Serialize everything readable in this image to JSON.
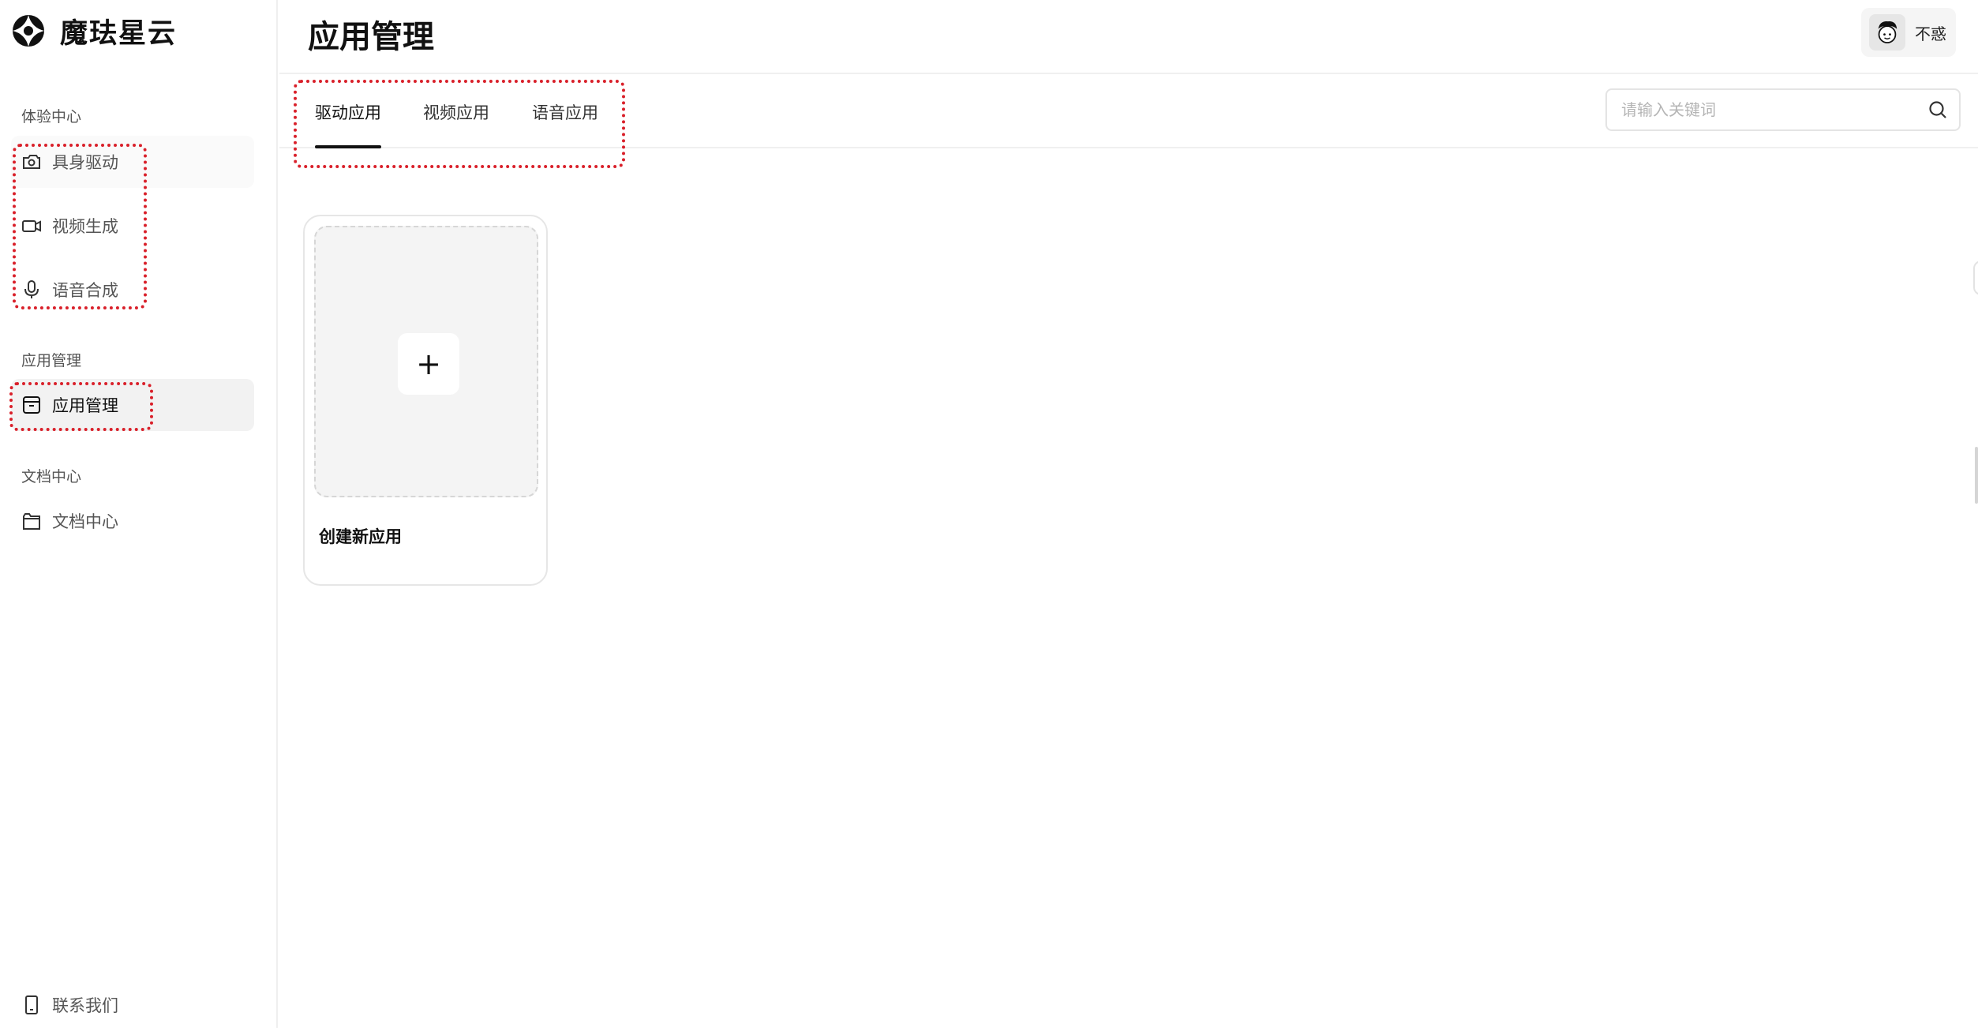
{
  "app": {
    "brand_name": "魔珐星云",
    "logo_icon": "clover-logo-icon"
  },
  "sidebar": {
    "sections": [
      {
        "title": "体验中心",
        "items": [
          {
            "label": "具身驱动",
            "icon": "camera-icon"
          },
          {
            "label": "视频生成",
            "icon": "video-camera-icon"
          },
          {
            "label": "语音合成",
            "icon": "microphone-icon"
          }
        ]
      },
      {
        "title": "应用管理",
        "items": [
          {
            "label": "应用管理",
            "icon": "archive-box-icon",
            "active": true
          }
        ]
      },
      {
        "title": "文档中心",
        "items": [
          {
            "label": "文档中心",
            "icon": "folder-icon"
          }
        ]
      }
    ],
    "footer": {
      "label": "联系我们",
      "icon": "phone-icon"
    }
  },
  "header": {
    "title": "应用管理",
    "user": {
      "name": "不惑",
      "avatar_icon": "cartoon-avatar-icon"
    }
  },
  "tabs": {
    "items": [
      {
        "label": "驱动应用",
        "active": true
      },
      {
        "label": "视频应用",
        "active": false
      },
      {
        "label": "语音应用",
        "active": false
      }
    ]
  },
  "search": {
    "placeholder": "请输入关键词",
    "value": ""
  },
  "content": {
    "create_card": {
      "plus": "+",
      "label": "创建新应用"
    }
  },
  "colors": {
    "annotation_red": "#d9202a",
    "active_tab_underline": "#111111",
    "active_nav_bg": "#f2f2f2"
  }
}
